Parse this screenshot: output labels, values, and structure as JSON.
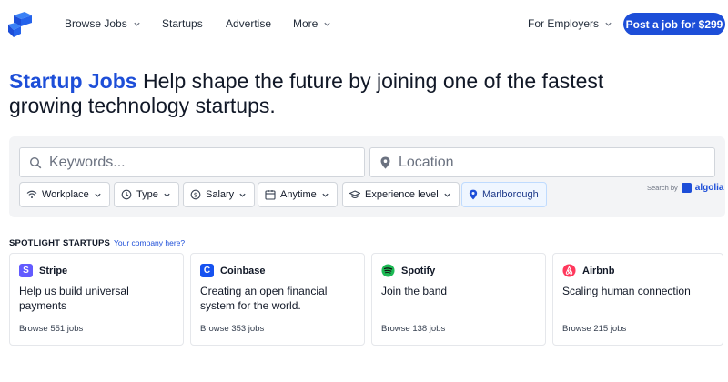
{
  "nav": {
    "items": [
      {
        "label": "Browse Jobs"
      },
      {
        "label": "Startups"
      },
      {
        "label": "Advertise"
      },
      {
        "label": "More"
      }
    ],
    "employers_label": "For Employers",
    "post_job_label": "Post a job for $299"
  },
  "hero": {
    "brand": "Startup Jobs",
    "tagline": "Help shape the future by joining one of the fastest growing technology startups."
  },
  "search": {
    "keywords_placeholder": "Keywords...",
    "location_placeholder": "Location",
    "filters": [
      {
        "label": "Workplace",
        "icon": "wifi-icon"
      },
      {
        "label": "Type",
        "icon": "clock-icon"
      },
      {
        "label": "Salary",
        "icon": "dollar-icon"
      },
      {
        "label": "Anytime",
        "icon": "calendar-icon"
      },
      {
        "label": "Experience level",
        "icon": "graduation-cap-icon"
      }
    ],
    "location_chip": "Marlborough",
    "powered_by": "Search by",
    "powered_brand": "algolia"
  },
  "spotlight": {
    "title": "SPOTLIGHT STARTUPS",
    "link": "Your company here?",
    "cards": [
      {
        "name": "Stripe",
        "tagline": "Help us build universal payments",
        "jobs": "Browse 551 jobs",
        "logo_color": "#635bff",
        "logo_letter": "S"
      },
      {
        "name": "Coinbase",
        "tagline": "Creating an open financial system for the world.",
        "jobs": "Browse 353 jobs",
        "logo_color": "#1652f0",
        "logo_letter": "C"
      },
      {
        "name": "Spotify",
        "tagline": "Join the band",
        "jobs": "Browse 138 jobs",
        "logo_color": "#1db954",
        "logo_letter": ""
      },
      {
        "name": "Airbnb",
        "tagline": "Scaling human connection",
        "jobs": "Browse 215 jobs",
        "logo_color": "#ff385c",
        "logo_letter": ""
      }
    ]
  },
  "colors": {
    "accent": "#1d4ed8",
    "panel_bg": "#f3f4f6"
  }
}
